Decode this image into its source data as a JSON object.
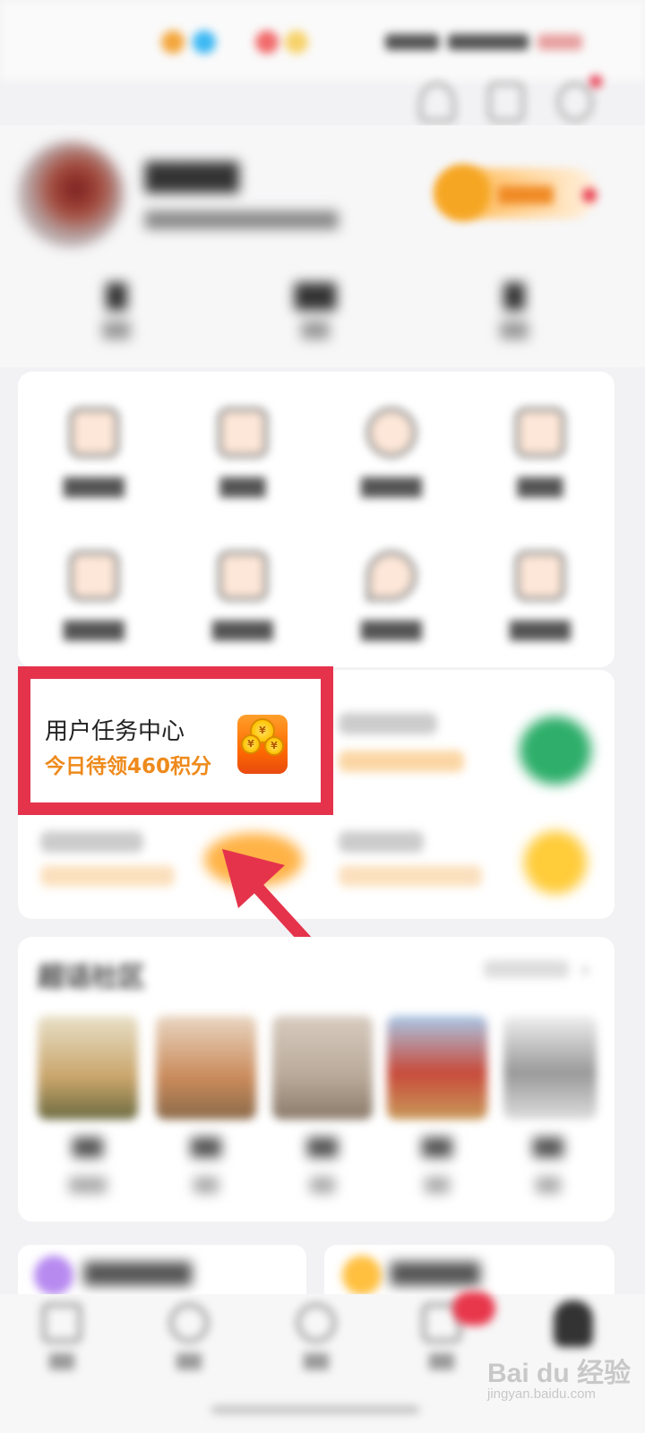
{
  "task_center": {
    "title": "用户任务中心",
    "subtitle": "今日待领460积分",
    "coin_symbol": "¥"
  },
  "community": {
    "title": "超话社区"
  },
  "watermark": {
    "brand": "Bai du 经验",
    "url": "jingyan.baidu.com"
  },
  "colors": {
    "highlight_frame": "#e5334c",
    "task_subtitle": "#ee8a1c",
    "accent_red": "#e8364b"
  },
  "icons": {
    "top_bar": [
      "person-icon",
      "scan-icon",
      "settings-icon"
    ],
    "tab_bar": [
      "home-icon",
      "discover-icon",
      "video-icon",
      "message-icon",
      "me-icon"
    ]
  }
}
